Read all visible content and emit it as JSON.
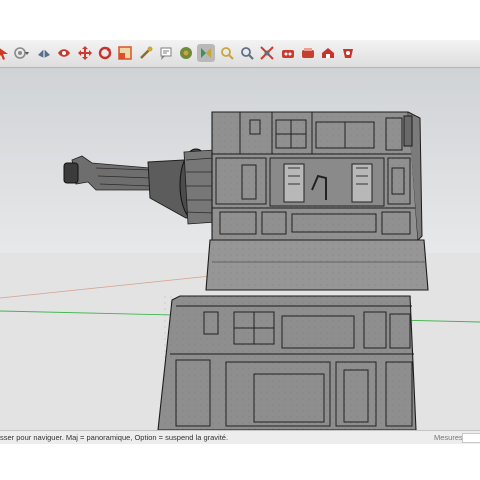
{
  "toolbar": {
    "tools": [
      {
        "name": "select-arrow-icon",
        "color": "#d03a20"
      },
      {
        "name": "orbit-dropdown-icon",
        "color": "#8a8a8a"
      },
      {
        "name": "position-camera-icon",
        "color": "#5a6e8c"
      },
      {
        "name": "look-around-icon",
        "color": "#c63a2c"
      },
      {
        "name": "move-icon",
        "color": "#d13b2e"
      },
      {
        "name": "rotate-icon",
        "color": "#c8322a"
      },
      {
        "name": "scale-icon",
        "color": "#d9502b"
      },
      {
        "name": "tape-measure-icon",
        "color": "#8b6b2a"
      },
      {
        "name": "text-tag-icon",
        "color": "#7d7d7d"
      },
      {
        "name": "paint-bucket-icon",
        "color": "#6f8b3a"
      },
      {
        "name": "orbit-icon",
        "color": "#3f8f5a"
      },
      {
        "name": "pan-icon",
        "color": "#caa63a"
      },
      {
        "name": "zoom-icon",
        "color": "#5f6f86"
      },
      {
        "name": "zoom-extents-icon",
        "color": "#d03a2a"
      },
      {
        "name": "walk-icon",
        "color": "#c83b2e"
      },
      {
        "name": "components-icon",
        "color": "#c73d30"
      },
      {
        "name": "warehouse-icon",
        "color": "#c8342b"
      }
    ],
    "active_tool": "orbit-icon"
  },
  "status_bar": {
    "hint": "sser pour naviguer. Maj = panoramique, Option =  suspend la gravité.",
    "measurements_label": "Mesures",
    "measurements_value": ""
  },
  "colors": {
    "sky": "#d3d6d9",
    "ground": "#e6e6e6",
    "model_face": "#8f8f8f",
    "model_face_dark": "#7a7a7a",
    "green_axis": "#3fb54f",
    "red_axis": "#d6a08c"
  }
}
